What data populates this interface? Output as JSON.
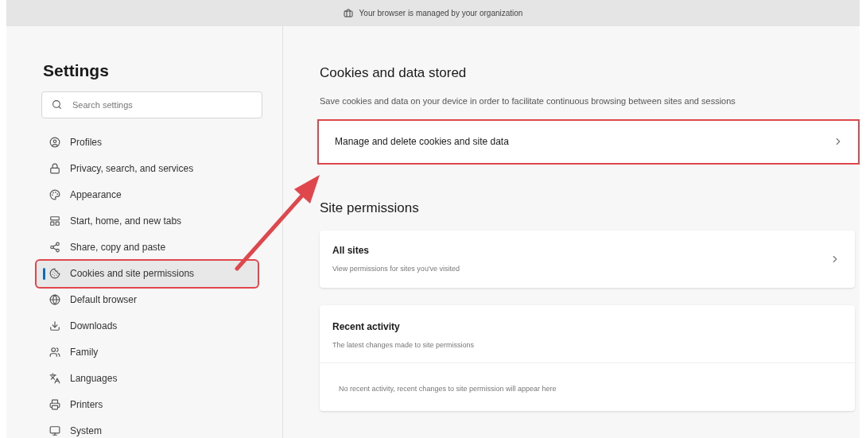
{
  "banner": {
    "text": "Your browser is managed by your organization"
  },
  "sidebar": {
    "title": "Settings",
    "search": {
      "placeholder": "Search settings"
    },
    "items": [
      {
        "label": "Profiles",
        "selected": false,
        "highlighted": false
      },
      {
        "label": "Privacy, search, and services",
        "selected": false,
        "highlighted": false
      },
      {
        "label": "Appearance",
        "selected": false,
        "highlighted": false
      },
      {
        "label": "Start, home, and new tabs",
        "selected": false,
        "highlighted": false
      },
      {
        "label": "Share, copy and paste",
        "selected": false,
        "highlighted": false
      },
      {
        "label": "Cookies and site permissions",
        "selected": true,
        "highlighted": true
      },
      {
        "label": "Default browser",
        "selected": false,
        "highlighted": false
      },
      {
        "label": "Downloads",
        "selected": false,
        "highlighted": false
      },
      {
        "label": "Family",
        "selected": false,
        "highlighted": false
      },
      {
        "label": "Languages",
        "selected": false,
        "highlighted": false
      },
      {
        "label": "Printers",
        "selected": false,
        "highlighted": false
      },
      {
        "label": "System",
        "selected": false,
        "highlighted": false
      }
    ]
  },
  "cookies_section": {
    "title": "Cookies and data stored",
    "description": "Save cookies and data on your device in order to facilitate continuous browsing between sites and sessions",
    "manage_row": {
      "label": "Manage and delete cookies and site data",
      "highlighted": true
    }
  },
  "permissions_section": {
    "title": "Site permissions",
    "all_sites": {
      "title": "All sites",
      "subtitle": "View permissions for sites you've visited"
    },
    "recent_activity": {
      "title": "Recent activity",
      "subtitle": "The latest changes made to site permissions",
      "empty_message": "No recent activity, recent changes to site permission will appear here"
    }
  }
}
